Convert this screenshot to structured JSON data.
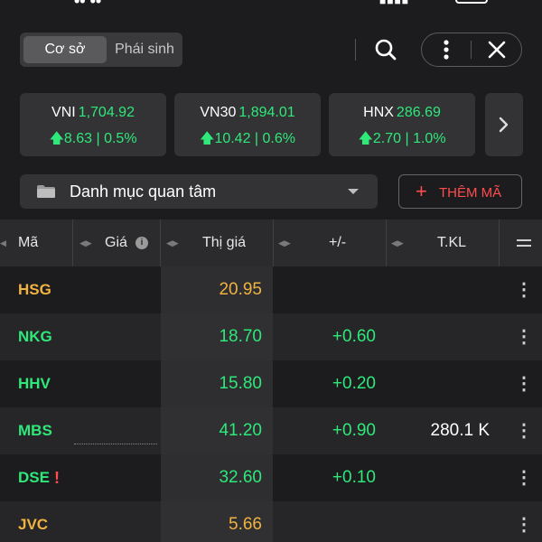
{
  "market_tabs": [
    "Cơ sở",
    "Phái sinh"
  ],
  "indices": [
    {
      "name": "VNI",
      "value": "1,704.92",
      "change": "8.63 | 0.5%"
    },
    {
      "name": "VN30",
      "value": "1,894.01",
      "change": "10.42 | 0.6%"
    },
    {
      "name": "HNX",
      "value": "286.69",
      "change": "2.70 | 1.0%"
    }
  ],
  "watchlist": {
    "label": "Danh mục quan tâm",
    "add_button": "THÊM MÃ"
  },
  "table": {
    "headers": {
      "symbol": "Mã",
      "bid": "Giá",
      "price": "Thị giá",
      "change": "+/-",
      "volume": "T.KL"
    },
    "rows": [
      {
        "symbol": "HSG",
        "price": "20.95",
        "change": "",
        "volume": "",
        "color": "#f0b341"
      },
      {
        "symbol": "NKG",
        "price": "18.70",
        "change": "+0.60",
        "volume": "",
        "color": "#2ee87a"
      },
      {
        "symbol": "HHV",
        "price": "15.80",
        "change": "+0.20",
        "volume": "",
        "color": "#2ee87a"
      },
      {
        "symbol": "MBS",
        "price": "41.20",
        "change": "+0.90",
        "volume": "280.1 K",
        "color": "#2ee87a"
      },
      {
        "symbol": "DSE",
        "price": "32.60",
        "change": "+0.10",
        "volume": "",
        "color": "#2ee87a",
        "warning": "!"
      },
      {
        "symbol": "JVC",
        "price": "5.66",
        "change": "",
        "volume": "",
        "color": "#f0b341"
      }
    ]
  },
  "colors": {
    "up": "#2ee87a",
    "reference": "#f0b341",
    "accent": "#ff4d4f",
    "background": "#1c1c1e"
  }
}
